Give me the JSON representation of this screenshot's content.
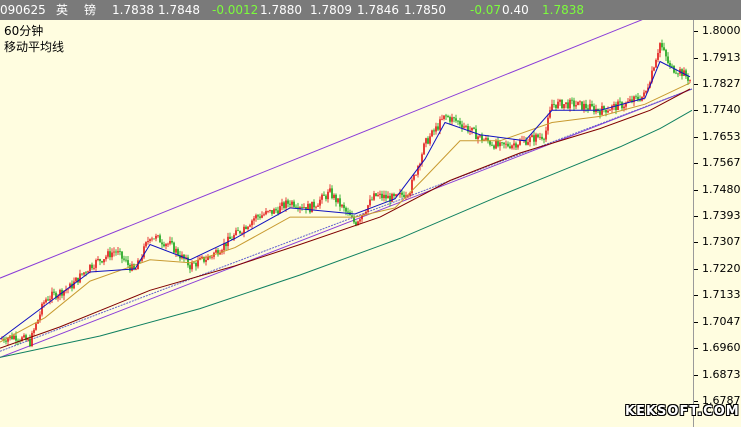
{
  "quote_bar": {
    "date": "090625",
    "name_part1": "英",
    "name_part2": "镑",
    "price1": "1.7838",
    "price2": "1.7848",
    "change": "-0.0012",
    "price3": "1.7880",
    "price4": "1.7809",
    "price5": "1.7846",
    "price6": "1.7850",
    "change_pct": "-0.07",
    "value": "0.40",
    "last": "1.7838"
  },
  "legend": {
    "period": "60分钟",
    "indicator": "移动平均线"
  },
  "watermark": "KEKSOFT.COM",
  "colors": {
    "background": "#fffde0",
    "up_candle": "#e01010",
    "down_candle": "#10a010",
    "channel": "#8a3cd8",
    "ma_fast": "#1010c0",
    "ma_mid": "#c89a30",
    "ma_slow": "#800000",
    "ma_long": "#108060"
  },
  "chart_data": {
    "type": "candlestick",
    "ylim": [
      1.6787,
      1.8
    ],
    "y_ticks": [
      "1.8000",
      "1.7913",
      "1.7827",
      "1.7740",
      "1.7653",
      "1.7567",
      "1.7480",
      "1.7393",
      "1.7307",
      "1.7220",
      "1.7133",
      "1.7047",
      "1.6960",
      "1.6873",
      "1.6787"
    ],
    "close_path": [
      [
        0,
        1.699
      ],
      [
        15,
        1.7
      ],
      [
        30,
        1.698
      ],
      [
        45,
        1.712
      ],
      [
        70,
        1.716
      ],
      [
        90,
        1.723
      ],
      [
        115,
        1.728
      ],
      [
        135,
        1.721
      ],
      [
        150,
        1.733
      ],
      [
        170,
        1.73
      ],
      [
        190,
        1.723
      ],
      [
        210,
        1.726
      ],
      [
        235,
        1.733
      ],
      [
        255,
        1.739
      ],
      [
        275,
        1.741
      ],
      [
        290,
        1.744
      ],
      [
        310,
        1.742
      ],
      [
        330,
        1.747
      ],
      [
        355,
        1.737
      ],
      [
        375,
        1.746
      ],
      [
        395,
        1.745
      ],
      [
        410,
        1.748
      ],
      [
        425,
        1.763
      ],
      [
        445,
        1.772
      ],
      [
        460,
        1.77
      ],
      [
        480,
        1.765
      ],
      [
        500,
        1.762
      ],
      [
        525,
        1.764
      ],
      [
        545,
        1.766
      ],
      [
        552,
        1.776
      ],
      [
        575,
        1.776
      ],
      [
        600,
        1.774
      ],
      [
        625,
        1.776
      ],
      [
        645,
        1.779
      ],
      [
        660,
        1.796
      ],
      [
        670,
        1.788
      ],
      [
        680,
        1.787
      ],
      [
        690,
        1.784
      ]
    ],
    "channel_upper": [
      [
        0,
        1.719
      ],
      [
        652,
        1.805
      ]
    ],
    "channel_lower_1": [
      [
        0,
        1.693
      ],
      [
        692,
        1.781
      ]
    ],
    "channel_lower_2": [
      [
        0,
        1.695
      ],
      [
        692,
        1.781
      ]
    ],
    "ma_fast": [
      [
        0,
        1.699
      ],
      [
        45,
        1.71
      ],
      [
        90,
        1.721
      ],
      [
        135,
        1.722
      ],
      [
        150,
        1.73
      ],
      [
        190,
        1.725
      ],
      [
        235,
        1.732
      ],
      [
        290,
        1.742
      ],
      [
        355,
        1.74
      ],
      [
        395,
        1.745
      ],
      [
        425,
        1.758
      ],
      [
        445,
        1.77
      ],
      [
        480,
        1.766
      ],
      [
        525,
        1.764
      ],
      [
        552,
        1.774
      ],
      [
        600,
        1.774
      ],
      [
        645,
        1.778
      ],
      [
        660,
        1.79
      ],
      [
        690,
        1.785
      ]
    ],
    "ma_mid": [
      [
        0,
        1.698
      ],
      [
        45,
        1.706
      ],
      [
        90,
        1.718
      ],
      [
        150,
        1.725
      ],
      [
        190,
        1.724
      ],
      [
        235,
        1.729
      ],
      [
        290,
        1.739
      ],
      [
        355,
        1.739
      ],
      [
        395,
        1.742
      ],
      [
        425,
        1.752
      ],
      [
        460,
        1.764
      ],
      [
        500,
        1.764
      ],
      [
        552,
        1.77
      ],
      [
        600,
        1.772
      ],
      [
        645,
        1.776
      ],
      [
        690,
        1.783
      ]
    ],
    "ma_slow": [
      [
        0,
        1.696
      ],
      [
        60,
        1.703
      ],
      [
        150,
        1.715
      ],
      [
        235,
        1.723
      ],
      [
        300,
        1.73
      ],
      [
        380,
        1.739
      ],
      [
        450,
        1.751
      ],
      [
        520,
        1.76
      ],
      [
        600,
        1.768
      ],
      [
        650,
        1.774
      ],
      [
        690,
        1.781
      ]
    ],
    "ma_long": [
      [
        0,
        1.693
      ],
      [
        100,
        1.7
      ],
      [
        200,
        1.709
      ],
      [
        300,
        1.72
      ],
      [
        400,
        1.732
      ],
      [
        500,
        1.746
      ],
      [
        560,
        1.754
      ],
      [
        620,
        1.762
      ],
      [
        660,
        1.768
      ],
      [
        692,
        1.774
      ]
    ]
  }
}
